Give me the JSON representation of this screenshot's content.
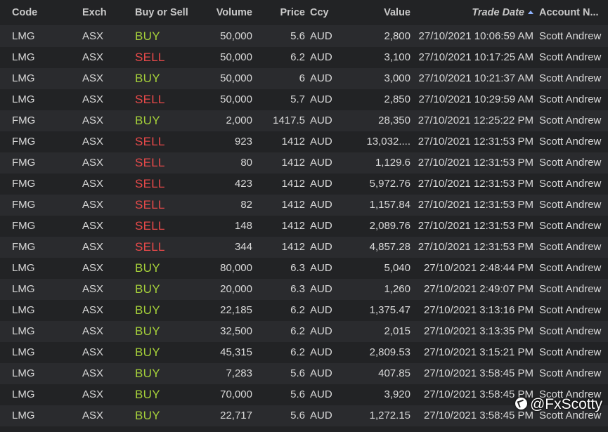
{
  "columns": {
    "code": "Code",
    "exch": "Exch",
    "side": "Buy or Sell",
    "volume": "Volume",
    "price": "Price",
    "ccy": "Ccy",
    "value": "Value",
    "trade_date": "Trade Date",
    "account": "Account N..."
  },
  "sort": {
    "column": "trade_date",
    "direction": "ascending",
    "icon": "sort-ascending-icon"
  },
  "colors": {
    "buy": "#a6d13a",
    "sell": "#ea4a4a"
  },
  "rows": [
    {
      "code": "LMG",
      "exch": "ASX",
      "side": "BUY",
      "volume": "50,000",
      "price": "5.6",
      "ccy": "AUD",
      "value": "2,800",
      "trade_date": "27/10/2021 10:06:59 AM",
      "account": "Scott Andrew"
    },
    {
      "code": "LMG",
      "exch": "ASX",
      "side": "SELL",
      "volume": "50,000",
      "price": "6.2",
      "ccy": "AUD",
      "value": "3,100",
      "trade_date": "27/10/2021 10:17:25 AM",
      "account": "Scott Andrew"
    },
    {
      "code": "LMG",
      "exch": "ASX",
      "side": "BUY",
      "volume": "50,000",
      "price": "6",
      "ccy": "AUD",
      "value": "3,000",
      "trade_date": "27/10/2021 10:21:37 AM",
      "account": "Scott Andrew"
    },
    {
      "code": "LMG",
      "exch": "ASX",
      "side": "SELL",
      "volume": "50,000",
      "price": "5.7",
      "ccy": "AUD",
      "value": "2,850",
      "trade_date": "27/10/2021 10:29:59 AM",
      "account": "Scott Andrew"
    },
    {
      "code": "FMG",
      "exch": "ASX",
      "side": "BUY",
      "volume": "2,000",
      "price": "1417.5",
      "ccy": "AUD",
      "value": "28,350",
      "trade_date": "27/10/2021 12:25:22 PM",
      "account": "Scott Andrew"
    },
    {
      "code": "FMG",
      "exch": "ASX",
      "side": "SELL",
      "volume": "923",
      "price": "1412",
      "ccy": "AUD",
      "value": "13,032....",
      "trade_date": "27/10/2021 12:31:53 PM",
      "account": "Scott Andrew"
    },
    {
      "code": "FMG",
      "exch": "ASX",
      "side": "SELL",
      "volume": "80",
      "price": "1412",
      "ccy": "AUD",
      "value": "1,129.6",
      "trade_date": "27/10/2021 12:31:53 PM",
      "account": "Scott Andrew"
    },
    {
      "code": "FMG",
      "exch": "ASX",
      "side": "SELL",
      "volume": "423",
      "price": "1412",
      "ccy": "AUD",
      "value": "5,972.76",
      "trade_date": "27/10/2021 12:31:53 PM",
      "account": "Scott Andrew"
    },
    {
      "code": "FMG",
      "exch": "ASX",
      "side": "SELL",
      "volume": "82",
      "price": "1412",
      "ccy": "AUD",
      "value": "1,157.84",
      "trade_date": "27/10/2021 12:31:53 PM",
      "account": "Scott Andrew"
    },
    {
      "code": "FMG",
      "exch": "ASX",
      "side": "SELL",
      "volume": "148",
      "price": "1412",
      "ccy": "AUD",
      "value": "2,089.76",
      "trade_date": "27/10/2021 12:31:53 PM",
      "account": "Scott Andrew"
    },
    {
      "code": "FMG",
      "exch": "ASX",
      "side": "SELL",
      "volume": "344",
      "price": "1412",
      "ccy": "AUD",
      "value": "4,857.28",
      "trade_date": "27/10/2021 12:31:53 PM",
      "account": "Scott Andrew"
    },
    {
      "code": "LMG",
      "exch": "ASX",
      "side": "BUY",
      "volume": "80,000",
      "price": "6.3",
      "ccy": "AUD",
      "value": "5,040",
      "trade_date": "27/10/2021 2:48:44 PM",
      "account": "Scott Andrew"
    },
    {
      "code": "LMG",
      "exch": "ASX",
      "side": "BUY",
      "volume": "20,000",
      "price": "6.3",
      "ccy": "AUD",
      "value": "1,260",
      "trade_date": "27/10/2021 2:49:07 PM",
      "account": "Scott Andrew"
    },
    {
      "code": "LMG",
      "exch": "ASX",
      "side": "BUY",
      "volume": "22,185",
      "price": "6.2",
      "ccy": "AUD",
      "value": "1,375.47",
      "trade_date": "27/10/2021 3:13:16 PM",
      "account": "Scott Andrew"
    },
    {
      "code": "LMG",
      "exch": "ASX",
      "side": "BUY",
      "volume": "32,500",
      "price": "6.2",
      "ccy": "AUD",
      "value": "2,015",
      "trade_date": "27/10/2021 3:13:35 PM",
      "account": "Scott Andrew"
    },
    {
      "code": "LMG",
      "exch": "ASX",
      "side": "BUY",
      "volume": "45,315",
      "price": "6.2",
      "ccy": "AUD",
      "value": "2,809.53",
      "trade_date": "27/10/2021 3:15:21 PM",
      "account": "Scott Andrew"
    },
    {
      "code": "LMG",
      "exch": "ASX",
      "side": "BUY",
      "volume": "7,283",
      "price": "5.6",
      "ccy": "AUD",
      "value": "407.85",
      "trade_date": "27/10/2021 3:58:45 PM",
      "account": "Scott Andrew"
    },
    {
      "code": "LMG",
      "exch": "ASX",
      "side": "BUY",
      "volume": "70,000",
      "price": "5.6",
      "ccy": "AUD",
      "value": "3,920",
      "trade_date": "27/10/2021 3:58:45 PM",
      "account": "Scott Andrew"
    },
    {
      "code": "LMG",
      "exch": "ASX",
      "side": "BUY",
      "volume": "22,717",
      "price": "5.6",
      "ccy": "AUD",
      "value": "1,272.15",
      "trade_date": "27/10/2021 3:58:45 PM",
      "account": "Scott Andrew"
    }
  ],
  "watermark": {
    "text": "@FxScotty",
    "icon": "social-logo-icon"
  }
}
